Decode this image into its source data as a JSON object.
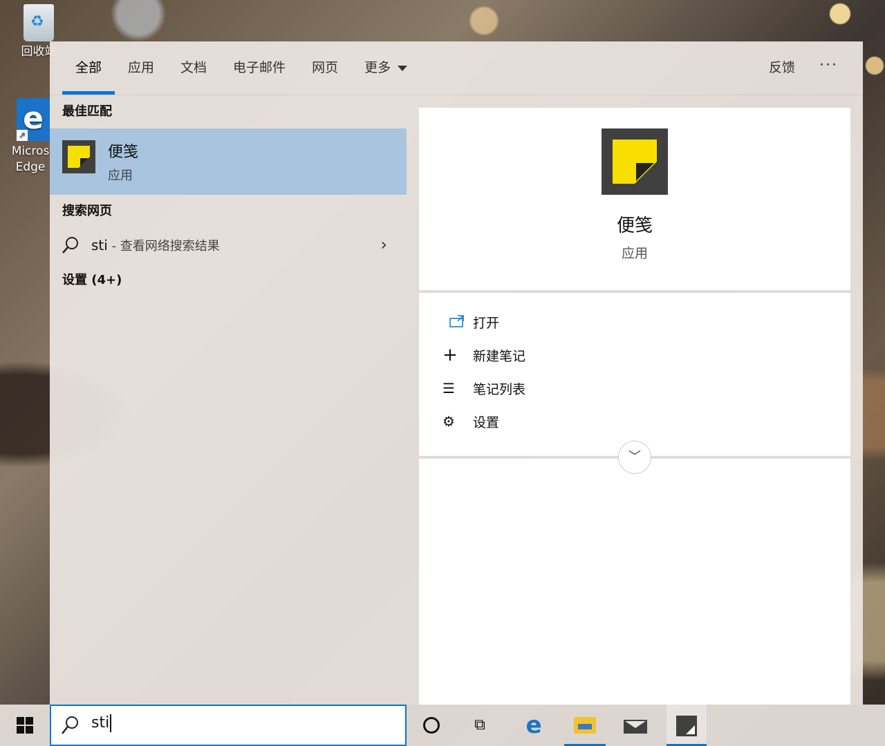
{
  "desktop": {
    "recycle_label": "回收站",
    "edge_label_1": "Micros",
    "edge_label_2": "Edge"
  },
  "tabs": [
    {
      "label": "全部",
      "active": true
    },
    {
      "label": "应用"
    },
    {
      "label": "文档"
    },
    {
      "label": "电子邮件"
    },
    {
      "label": "网页"
    },
    {
      "label": "更多"
    }
  ],
  "header": {
    "feedback": "反馈",
    "more_options": "···"
  },
  "results": {
    "best_match_title": "最佳匹配",
    "best_match": {
      "name": "便笺",
      "type": "应用"
    },
    "web_title": "搜索网页",
    "web_query": "sti",
    "web_desc": " - 查看网络搜索结果",
    "settings_title": "设置 (4+)"
  },
  "preview": {
    "name": "便笺",
    "type": "应用",
    "actions": [
      {
        "label": "打开",
        "icon": "open-icon"
      },
      {
        "label": "新建笔记",
        "icon": "plus-icon"
      },
      {
        "label": "笔记列表",
        "icon": "list-icon"
      },
      {
        "label": "设置",
        "icon": "gear-icon"
      }
    ]
  },
  "taskbar": {
    "search_text": "sti"
  },
  "colors": {
    "accent": "#0078d7",
    "sticky_yellow": "#f7e000",
    "sticky_dark": "#404040",
    "selected_row": "#a8c4de"
  }
}
